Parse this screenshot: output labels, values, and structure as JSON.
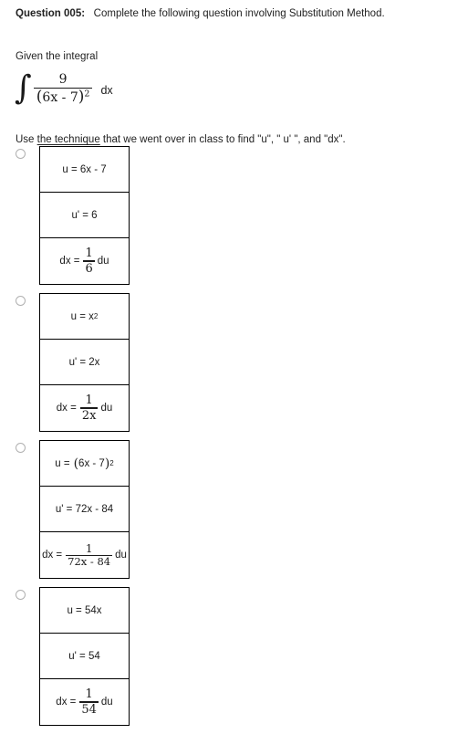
{
  "question": {
    "label": "Question 005:",
    "text": "Complete the following question involving Substitution Method.",
    "given_label": "Given the integral",
    "instruction_prefix": "Use ",
    "instruction_underlined": "the technique",
    "instruction_suffix": " that we went over in class to find \"u\", \" u' \", and \"dx\"."
  },
  "integral": {
    "sign": "∫",
    "numerator": "9",
    "denominator_open_paren": "(",
    "denominator_base": "6x - 7",
    "denominator_close_paren": ")",
    "denominator_exponent": "2",
    "differential": "dx"
  },
  "options": [
    {
      "id": "option-a",
      "selected": false,
      "cells": [
        {
          "name": "u-cell",
          "text": "u = 6x - 7"
        },
        {
          "name": "u-prime-cell",
          "text": "u' = 6"
        },
        {
          "name": "dx-cell",
          "lead": "dx =",
          "numerator": "1",
          "denominator": "6",
          "trail": "du"
        }
      ]
    },
    {
      "id": "option-b",
      "selected": false,
      "cells": [
        {
          "name": "u-cell",
          "base": "u = x",
          "exponent": "2"
        },
        {
          "name": "u-prime-cell",
          "text": "u' = 2x"
        },
        {
          "name": "dx-cell",
          "lead": "dx =",
          "numerator": "1",
          "denominator": "2x",
          "trail": "du"
        }
      ]
    },
    {
      "id": "option-c",
      "selected": false,
      "cells": [
        {
          "name": "u-cell",
          "lead_text": "u =",
          "paren_open": "(",
          "paren_content": "6x - 7",
          "paren_close": ")",
          "exponent": "2"
        },
        {
          "name": "u-prime-cell",
          "text": "u' = 72x - 84"
        },
        {
          "name": "dx-cell",
          "lead": "dx =",
          "numerator": "1",
          "denominator": "72x - 84",
          "trail": "du"
        }
      ]
    },
    {
      "id": "option-d",
      "selected": false,
      "cells": [
        {
          "name": "u-cell",
          "text": "u = 54x"
        },
        {
          "name": "u-prime-cell",
          "text": "u' = 54"
        },
        {
          "name": "dx-cell",
          "lead": "dx =",
          "numerator": "1",
          "denominator": "54",
          "trail": "du"
        }
      ]
    }
  ],
  "colors": {
    "text": "#222222",
    "box_border": "#000000",
    "radio_border": "#b0b0b0",
    "background": "#ffffff"
  }
}
